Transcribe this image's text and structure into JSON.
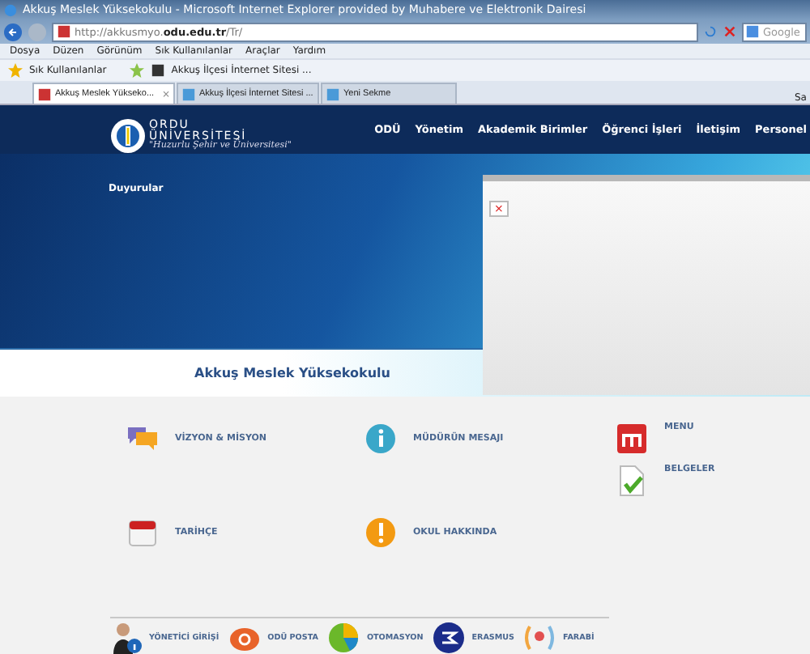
{
  "window": {
    "title": "Akkuş Meslek Yüksekokulu - Microsoft Internet Explorer provided by Muhabere ve Elektronik Dairesi"
  },
  "address_bar": {
    "url_prefix": "http://akkusmyo.",
    "url_domain": "odu.edu.tr",
    "url_suffix": "/Tr/"
  },
  "search": {
    "placeholder": "Google"
  },
  "menu": [
    "Dosya",
    "Düzen",
    "Görünüm",
    "Sık Kullanılanlar",
    "Araçlar",
    "Yardım"
  ],
  "favorites": [
    "Sık Kullanılanlar",
    "Akkuş İlçesi İnternet Sitesi ..."
  ],
  "tabs": [
    {
      "label": "Akkuş Meslek Yükseko...",
      "selected": true,
      "close": "×"
    },
    {
      "label": "Akkuş İlçesi İnternet Sitesi ...",
      "selected": false
    },
    {
      "label": "Yeni Sekme",
      "selected": false
    }
  ],
  "toolbar_text": "Sa",
  "site": {
    "logo": {
      "line1": "ORDU",
      "line2": "ÜNİVERSİTESİ",
      "tagline": "\"Huzurlu Şehir ve Üniversitesi\""
    },
    "nav": [
      "ODÜ",
      "Yönetim",
      "Akademik Birimler",
      "Öğrenci İşleri",
      "İletişim",
      "Personel"
    ],
    "announcements": "Duyurular",
    "popup": {
      "close": "×"
    },
    "heading": "Akkuş Meslek Yüksekokulu",
    "link_columns": [
      [
        {
          "label": "VİZYON & MİSYON",
          "kind": "chat"
        },
        {
          "label": "TARİHÇE",
          "kind": "calendar"
        }
      ],
      [
        {
          "label": "MÜDÜRÜN MESAJI",
          "kind": "info"
        },
        {
          "label": "OKUL HAKKINDA",
          "kind": "alert"
        }
      ],
      [
        {
          "label": "MENU",
          "kind": "menu"
        },
        {
          "label": "BELGELER",
          "kind": "document"
        }
      ]
    ],
    "footer": [
      {
        "label": "YÖNETİCİ GİRİŞİ",
        "kind": "person"
      },
      {
        "label": "ODÜ POSTA",
        "kind": "mail"
      },
      {
        "label": "OTOMASYON",
        "kind": "pie"
      },
      {
        "label": "ERASMUS",
        "kind": "erasmus"
      },
      {
        "label": "FARABİ",
        "kind": "farabi"
      }
    ]
  }
}
